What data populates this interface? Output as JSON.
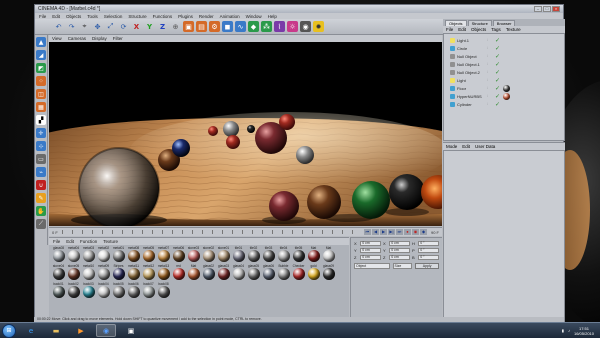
{
  "window": {
    "title": "CINEMA 4D - [Marbel.c4d *]"
  },
  "menubar": [
    "File",
    "Edit",
    "Objects",
    "Tools",
    "Selection",
    "Structure",
    "Functions",
    "Plugins",
    "Render",
    "Animation",
    "Window",
    "Help"
  ],
  "viewport": {
    "menu": [
      "View",
      "Cameras",
      "Display",
      "Filter"
    ]
  },
  "timeline": {
    "frame": "0 F",
    "end": "90 F"
  },
  "material_manager": {
    "menu": [
      "File",
      "Edit",
      "Function",
      "Texture"
    ],
    "materials": [
      {
        "name": "glass08",
        "color": "#9aa0a6"
      },
      {
        "name": "metal04",
        "color": "#c9c9c9"
      },
      {
        "name": "metal03",
        "color": "#a8a8a8"
      },
      {
        "name": "metal02",
        "color": "#dedede"
      },
      {
        "name": "metal01",
        "color": "#7a7a7a"
      },
      {
        "name": "metal08",
        "color": "#8c5a2a"
      },
      {
        "name": "metal05",
        "color": "#b07030"
      },
      {
        "name": "metal07",
        "color": "#c08840"
      },
      {
        "name": "metal06",
        "color": "#6a4a2a"
      },
      {
        "name": "stone03",
        "color": "#c06060"
      },
      {
        "name": "stone02",
        "color": "#b09a80"
      },
      {
        "name": "stone01",
        "color": "#a89070"
      },
      {
        "name": "tile01",
        "color": "#707080"
      },
      {
        "name": "tile02",
        "color": "#6a6a6a"
      },
      {
        "name": "tile03",
        "color": "#505050"
      },
      {
        "name": "tile04",
        "color": "#a0a0a0"
      },
      {
        "name": "tile05",
        "color": "#3a3a3a"
      },
      {
        "name": "Mat",
        "color": "#8a2020"
      },
      {
        "name": "Mat",
        "color": "#d0d0d0"
      },
      {
        "name": "stone04",
        "color": "#444"
      },
      {
        "name": "stone05",
        "color": "#6b3a2a"
      },
      {
        "name": "metal10",
        "color": "#cfcfcf"
      },
      {
        "name": "metal09",
        "color": "#a0a0a0"
      },
      {
        "name": "Stripes",
        "color": "#2a2a5a"
      },
      {
        "name": "metal11",
        "color": "#8a6a3a"
      },
      {
        "name": "metal12",
        "color": "#c0a060"
      },
      {
        "name": "metal13",
        "color": "#9a6020"
      },
      {
        "name": "red",
        "color": "#c0302a"
      },
      {
        "name": "Mat",
        "color": "#b05a30"
      },
      {
        "name": "glass02",
        "color": "#556070"
      },
      {
        "name": "glass03",
        "color": "#7a2a2a"
      },
      {
        "name": "glass04",
        "color": "#c0c0c0"
      },
      {
        "name": "glass05",
        "color": "#707070"
      },
      {
        "name": "glass06",
        "color": "#606878"
      },
      {
        "name": "Bubble",
        "color": "#888"
      },
      {
        "name": "Checker",
        "color": "#b02a2a"
      },
      {
        "name": "gold",
        "color": "#e0b020"
      },
      {
        "name": "glass09",
        "color": "#303030"
      },
      {
        "name": "back01",
        "color": "#556060"
      },
      {
        "name": "back02",
        "color": "#4a4a4a"
      },
      {
        "name": "back03",
        "color": "#2a8a9a"
      },
      {
        "name": "back04",
        "color": "#c8c8c8"
      },
      {
        "name": "back05",
        "color": "#7a7a7a"
      },
      {
        "name": "back06",
        "color": "#6a6a6a"
      },
      {
        "name": "back07",
        "color": "#9aa0a0"
      },
      {
        "name": "back08",
        "color": "#5a5a5a"
      }
    ]
  },
  "coords": {
    "rows": [
      {
        "a": "X",
        "v1": "0 cm",
        "b": "X",
        "v2": "0 cm",
        "c": "H",
        "v3": "0 °"
      },
      {
        "a": "Y",
        "v1": "0 cm",
        "b": "Y",
        "v2": "0 cm",
        "c": "P",
        "v3": "0 °"
      },
      {
        "a": "Z",
        "v1": "0 cm",
        "b": "Z",
        "v2": "0 cm",
        "c": "B",
        "v3": "0 °"
      }
    ],
    "mode": "Object",
    "size_mode": "Size",
    "apply": "Apply"
  },
  "object_manager": {
    "tabs": [
      "Objects",
      "Structure",
      "Browser"
    ],
    "menu": [
      "File",
      "Edit",
      "Objects",
      "Tags",
      "Texture"
    ],
    "objects": [
      {
        "name": "Light.1",
        "icon": "#f0e060",
        "tag": ""
      },
      {
        "name": "Circle",
        "icon": "#40a0d0",
        "tag": ""
      },
      {
        "name": "Null Object",
        "icon": "#909090",
        "tag": ""
      },
      {
        "name": "Null Object.1",
        "icon": "#909090",
        "tag": ""
      },
      {
        "name": "Null Object.2",
        "icon": "#909090",
        "tag": ""
      },
      {
        "name": "Light",
        "icon": "#f0e060",
        "tag": ""
      },
      {
        "name": "Floor",
        "icon": "#40a0d0",
        "tag": "#3a3a3a"
      },
      {
        "name": "HyperNURBS",
        "icon": "#40a0d0",
        "tag": "#c05030"
      },
      {
        "name": "Cylinder",
        "icon": "#40a0d0",
        "tag": ""
      }
    ]
  },
  "attributes_manager": {
    "menu": [
      "Mode",
      "Edit",
      "User Data"
    ]
  },
  "status": "00:00:22  Move: Click and drag to move elements. Hold down SHIFT to quantize movement / add to the selection in point mode, CTRL to remove.",
  "taskbar": {
    "time": "17:51",
    "date": "16/05/2010"
  }
}
